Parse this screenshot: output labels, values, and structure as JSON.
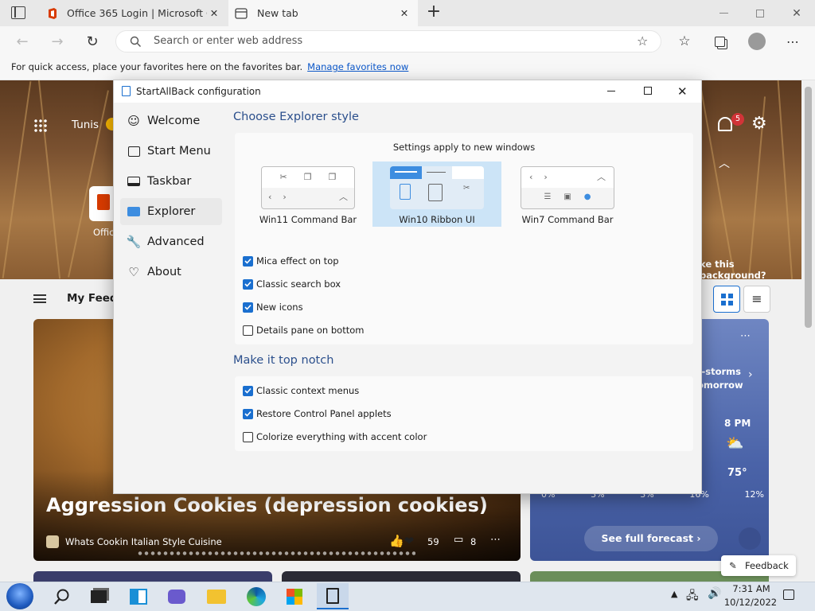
{
  "browser": {
    "tabs": [
      {
        "title": "Office 365 Login | Microsoft Offi"
      },
      {
        "title": "New tab"
      }
    ],
    "address_placeholder": "Search or enter web address",
    "favorites_bar": {
      "text": "For quick access, place your favorites here on the favorites bar.",
      "link": "Manage favorites now"
    }
  },
  "page": {
    "location": "Tunis",
    "office_label": "Offic",
    "notification_count": "5",
    "background_question": "ke this background?",
    "feed_label": "My Feed",
    "article": {
      "title": "Aggression Cookies (depression cookies)",
      "source": "Whats Cookin Italian Style Cuisine",
      "reactions": "59",
      "comments": "8"
    },
    "weather": {
      "alert": "t-storms\nomorrow",
      "hour": "8 PM",
      "temp": "75°",
      "precip": [
        "0%",
        "3%",
        "3%",
        "16%",
        "12%"
      ],
      "forecast_button": "See full forecast"
    },
    "feedback": "Feedback"
  },
  "dialog": {
    "title": "StartAllBack configuration",
    "sidebar": [
      {
        "label": "Welcome",
        "icon": "smile-icon"
      },
      {
        "label": "Start Menu",
        "icon": "start-menu-icon"
      },
      {
        "label": "Taskbar",
        "icon": "taskbar-icon"
      },
      {
        "label": "Explorer",
        "icon": "folder-icon",
        "selected": true
      },
      {
        "label": "Advanced",
        "icon": "wrench-icon"
      },
      {
        "label": "About",
        "icon": "heart-icon"
      }
    ],
    "explorer_heading": "Choose Explorer style",
    "settings_note": "Settings apply to new windows",
    "styles": [
      {
        "label": "Win11 Command Bar",
        "selected": false
      },
      {
        "label": "Win10 Ribbon UI",
        "selected": true
      },
      {
        "label": "Win7 Command Bar",
        "selected": false
      }
    ],
    "explorer_options": [
      {
        "label": "Mica effect on top",
        "checked": true
      },
      {
        "label": "Classic search box",
        "checked": true
      },
      {
        "label": "New icons",
        "checked": true
      },
      {
        "label": "Details pane on bottom",
        "checked": false
      }
    ],
    "notch_heading": "Make it top notch",
    "notch_options": [
      {
        "label": "Classic context menus",
        "checked": true
      },
      {
        "label": "Restore Control Panel applets",
        "checked": true
      },
      {
        "label": "Colorize everything with accent color",
        "checked": false
      }
    ]
  },
  "taskbar": {
    "time": "7:31 AM",
    "date": "10/12/2022"
  },
  "colors": {
    "accent": "#1a6fcf",
    "heading": "#2b4f8c",
    "selected_tile": "#cce4f7"
  }
}
